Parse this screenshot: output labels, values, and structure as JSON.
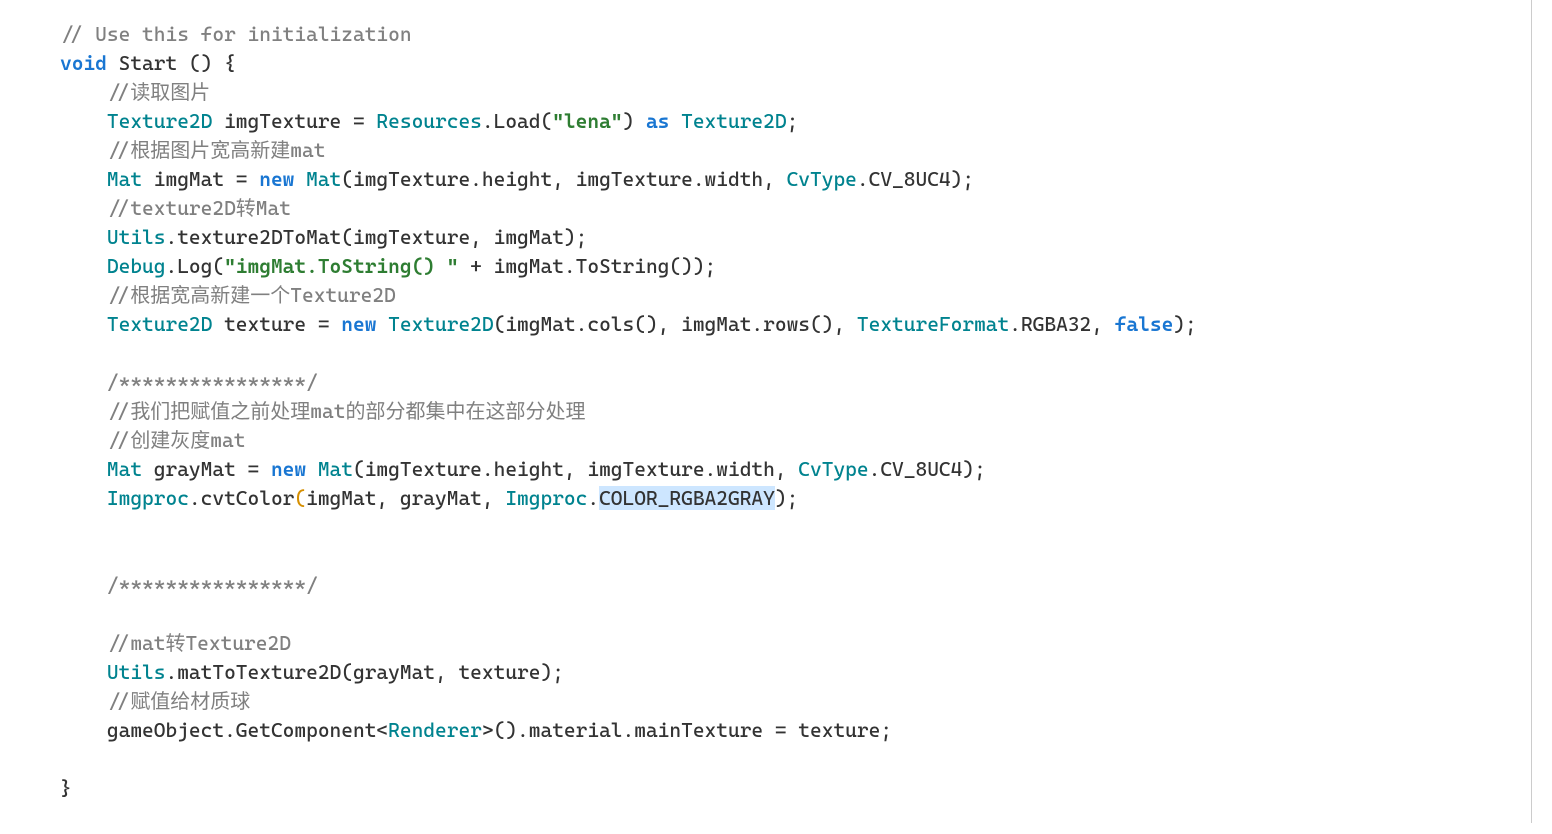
{
  "code": {
    "l01": "// Use this for initialization",
    "l02_kw": "void",
    "l02_name": " Start () {",
    "l03": "//读取图片",
    "l04_t1": "Texture2D",
    "l04_a": " imgTexture = ",
    "l04_cls": "Resources",
    "l04_b": ".Load(",
    "l04_str": "\"lena\"",
    "l04_c": ") ",
    "l04_as": "as",
    "l04_d": " ",
    "l04_t2": "Texture2D",
    "l04_e": ";",
    "l05": "//根据图片宽高新建mat",
    "l06_t": "Mat",
    "l06_a": " imgMat = ",
    "l06_new": "new",
    "l06_b": " ",
    "l06_ctor": "Mat",
    "l06_c": "(imgTexture.height, imgTexture.width, ",
    "l06_cls": "CvType",
    "l06_d": ".CV_8UC4);",
    "l07": "//texture2D转Mat",
    "l08_cls": "Utils",
    "l08_a": ".texture2DToMat(imgTexture, imgMat);",
    "l09_cls": "Debug",
    "l09_a": ".Log(",
    "l09_str": "\"imgMat.ToString() \"",
    "l09_b": " + imgMat.ToString());",
    "l10": "//根据宽高新建一个Texture2D",
    "l11_t": "Texture2D",
    "l11_a": " texture = ",
    "l11_new": "new",
    "l11_b": " ",
    "l11_ctor": "Texture2D",
    "l11_c": "(imgMat.cols(), imgMat.rows(), ",
    "l11_cls": "TextureFormat",
    "l11_d": ".RGBA32, ",
    "l11_false": "false",
    "l11_e": ");",
    "l13": "/****************/",
    "l14": "//我们把赋值之前处理mat的部分都集中在这部分处理",
    "l15": "//创建灰度mat",
    "l16_t": "Mat",
    "l16_a": " grayMat = ",
    "l16_new": "new",
    "l16_b": " ",
    "l16_ctor": "Mat",
    "l16_c": "(imgTexture.height, imgTexture.width, ",
    "l16_cls": "CvType",
    "l16_d": ".CV_8UC4);",
    "l17_cls": "Imgproc",
    "l17_a": ".cvtColor",
    "l17_paren": "(",
    "l17_b": "imgMat, grayMat, ",
    "l17_cls2": "Imgproc",
    "l17_c": ".",
    "l17_const": "COLOR_RGBA2GRAY",
    "l17_d": ");",
    "l19": "/****************/",
    "l21": "//mat转Texture2D",
    "l22_cls": "Utils",
    "l22_a": ".matToTexture2D(grayMat, texture);",
    "l23": "//赋值给材质球",
    "l24_a": "gameObject.GetComponent<",
    "l24_t": "Renderer",
    "l24_b": ">().material.mainTexture = texture;",
    "l26": "}"
  }
}
